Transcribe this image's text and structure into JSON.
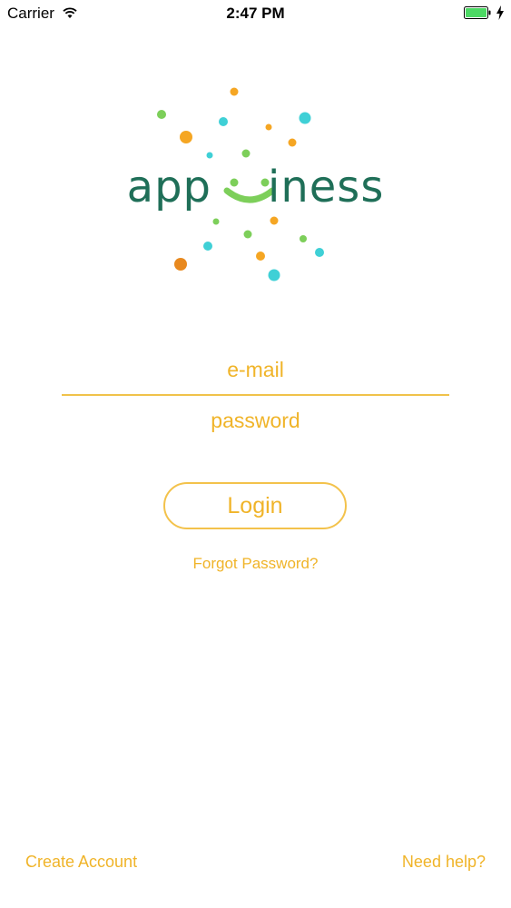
{
  "status_bar": {
    "carrier": "Carrier",
    "time": "2:47 PM",
    "icons": [
      "wifi-icon",
      "battery-icon",
      "charging-bolt-icon"
    ],
    "battery_color": "#4cd964"
  },
  "logo": {
    "left_text": "app",
    "right_text": "iness",
    "brand_color": "#1f6f58",
    "smile_color": "#7dcf5a",
    "dot_colors": [
      "#f5a623",
      "#7dcf5a",
      "#3fd0d6",
      "#e8891f"
    ]
  },
  "login_form": {
    "email_placeholder": "e-mail",
    "password_placeholder": "password",
    "login_label": "Login",
    "forgot_label": "Forgot Password?",
    "accent_color": "#f0b429"
  },
  "footer": {
    "create_account_label": "Create Account",
    "need_help_label": "Need help?"
  }
}
